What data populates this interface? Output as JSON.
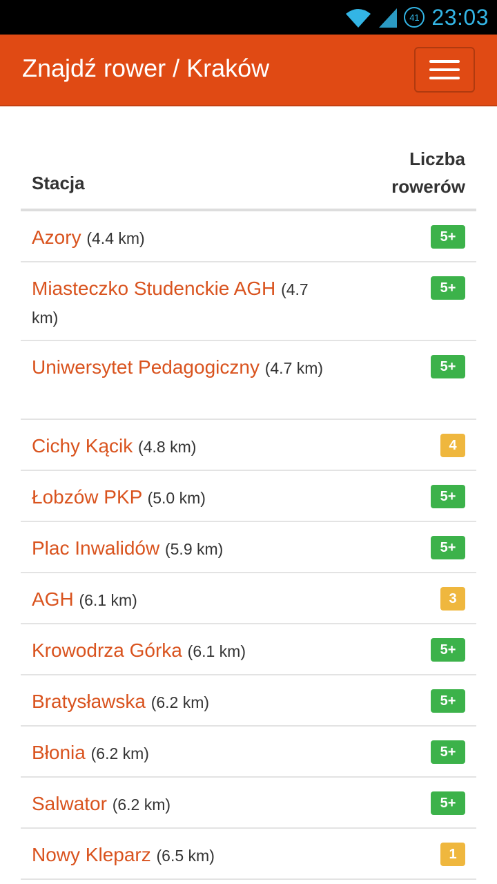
{
  "statusbar": {
    "battery": "41",
    "time": "23:03",
    "accent": "#33b5e5"
  },
  "appbar": {
    "title": "Znajdź rower / Kraków",
    "menu_icon": "hamburger-menu-icon",
    "color": "#e04a14"
  },
  "table": {
    "headers": {
      "station": "Stacja",
      "count_line1": "Liczba",
      "count_line2": "rowerów"
    },
    "rows": [
      {
        "name": "Azory",
        "distance": "(4.4 km)",
        "bikes": "5+",
        "status": "green"
      },
      {
        "name": "Miasteczko Studenckie AGH",
        "distance": "(4.7 km)",
        "bikes": "5+",
        "status": "green"
      },
      {
        "name": "Uniwersytet Pedagogiczny",
        "distance": "(4.7 km)",
        "bikes": "5+",
        "status": "green"
      },
      {
        "name": "Cichy Kącik",
        "distance": "(4.8 km)",
        "bikes": "4",
        "status": "yellow"
      },
      {
        "name": "Łobzów PKP",
        "distance": "(5.0 km)",
        "bikes": "5+",
        "status": "green"
      },
      {
        "name": "Plac Inwalidów",
        "distance": "(5.9 km)",
        "bikes": "5+",
        "status": "green"
      },
      {
        "name": "AGH",
        "distance": "(6.1 km)",
        "bikes": "3",
        "status": "yellow"
      },
      {
        "name": "Krowodrza Górka",
        "distance": "(6.1 km)",
        "bikes": "5+",
        "status": "green"
      },
      {
        "name": "Bratysławska",
        "distance": "(6.2 km)",
        "bikes": "5+",
        "status": "green"
      },
      {
        "name": "Błonia",
        "distance": "(6.2 km)",
        "bikes": "5+",
        "status": "green"
      },
      {
        "name": "Salwator",
        "distance": "(6.2 km)",
        "bikes": "5+",
        "status": "green"
      },
      {
        "name": "Nowy Kleparz",
        "distance": "(6.5 km)",
        "bikes": "1",
        "status": "yellow"
      }
    ]
  },
  "colors": {
    "link": "#d9531e",
    "badge_green": "#3cb24a",
    "badge_yellow": "#efb73e"
  }
}
